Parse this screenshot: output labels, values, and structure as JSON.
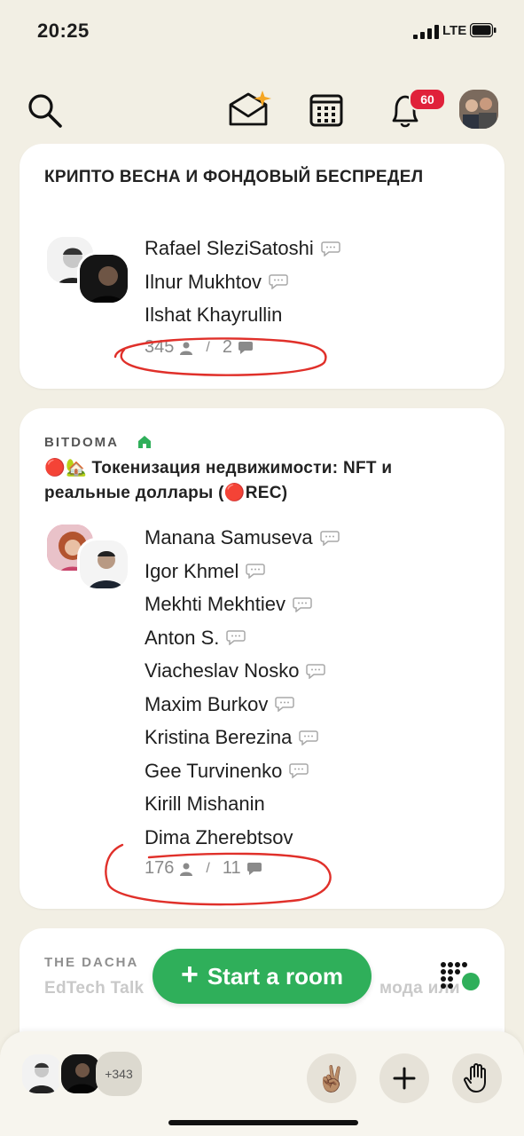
{
  "status_bar": {
    "time": "20:25",
    "network": "LTE"
  },
  "topbar": {
    "notifications_count": "60"
  },
  "rooms": [
    {
      "club": "",
      "title": "КРИПТО ВЕСНА И ФОНДОВЫЙ БЕСПРЕДЕЛ",
      "speakers": [
        "Rafael SleziSatoshi",
        "Ilnur Mukhtov",
        "Ilshat Khayrullin"
      ],
      "listeners": "345",
      "speakers_count": "2"
    },
    {
      "club": "BITDOMA",
      "title": "🔴🏡 Токенизация недвижимости: NFT и реальные доллары (🔴REC)",
      "speakers": [
        "Manana Samuseva",
        "Igor Khmel",
        "Mekhti Mekhtiev",
        "Anton S.",
        "Viacheslav Nosko",
        "Maxim Burkov",
        "Kristina Berezina",
        "Gee Turvinenko",
        "Kirill Mishanin",
        "Dima Zherebtsov"
      ],
      "listeners": "176",
      "speakers_count": "11"
    },
    {
      "club": "THE DACHA",
      "title": "EdTech Talk",
      "title_tail": "мода или"
    }
  ],
  "start_room_label": "Start a room",
  "bottom_bar": {
    "more_count": "+343"
  },
  "colors": {
    "accent_green": "#2faf5a",
    "badge_red": "#e0213a",
    "background": "#f2efe4"
  }
}
